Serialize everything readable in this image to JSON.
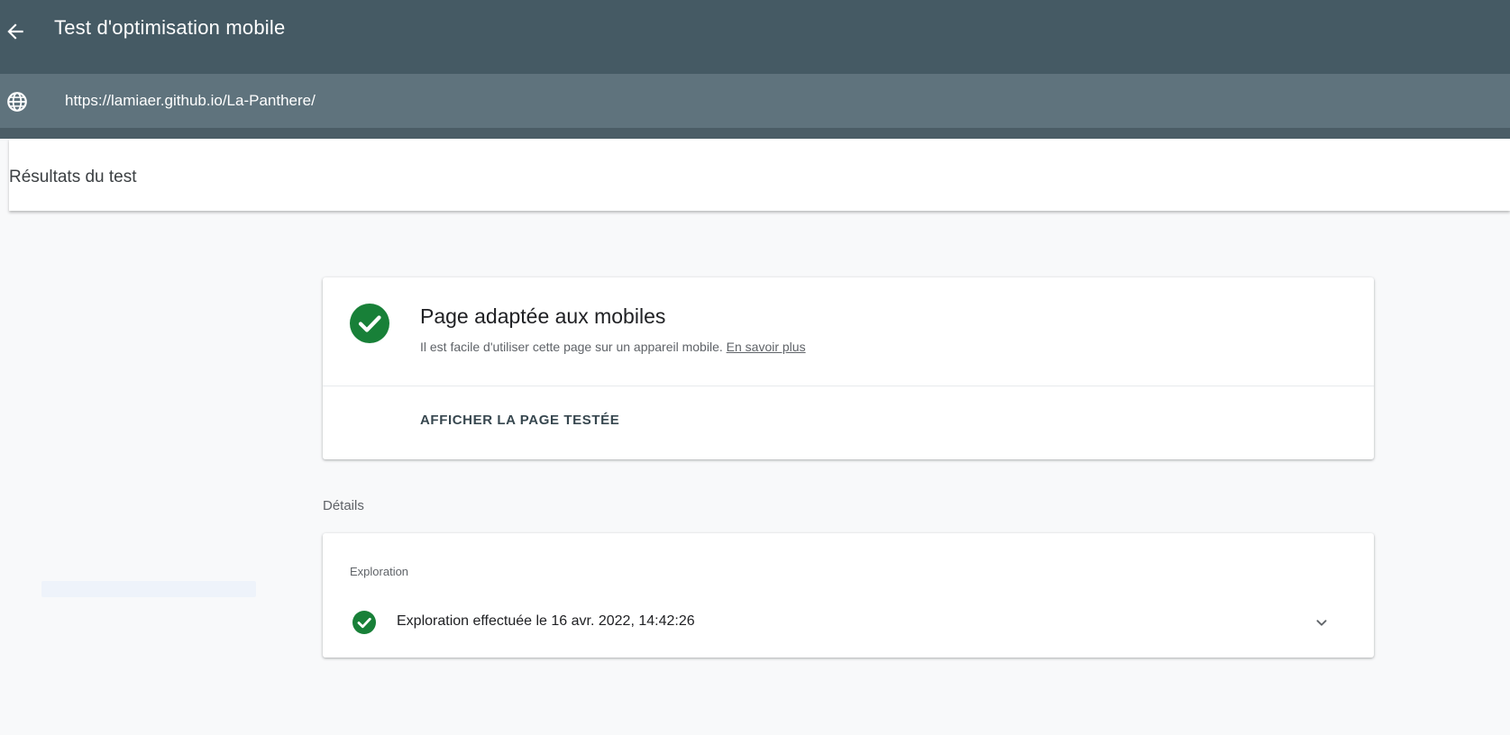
{
  "header": {
    "title": "Test d'optimisation mobile",
    "back_icon": "arrow-back-icon",
    "bg_color": "#455a64"
  },
  "url_bar": {
    "icon": "globe-icon",
    "url": "https://lamiaer.github.io/La-Panthere/",
    "bg_color": "#5f737d"
  },
  "results": {
    "title": "Résultats du test"
  },
  "summary_card": {
    "status_icon": "check-circle-icon",
    "status_color": "#188038",
    "title": "Page adaptée aux mobiles",
    "description": "Il est facile d'utiliser cette page sur un appareil mobile.",
    "learn_more": "En savoir plus",
    "view_tested_page": "AFFICHER LA PAGE TESTÉE"
  },
  "details": {
    "label": "Détails",
    "section": "Exploration",
    "row_icon": "check-circle-icon",
    "row_text": "Exploration effectuée le 16 avr. 2022, 14:42:26",
    "expand_icon": "chevron-down-icon"
  }
}
